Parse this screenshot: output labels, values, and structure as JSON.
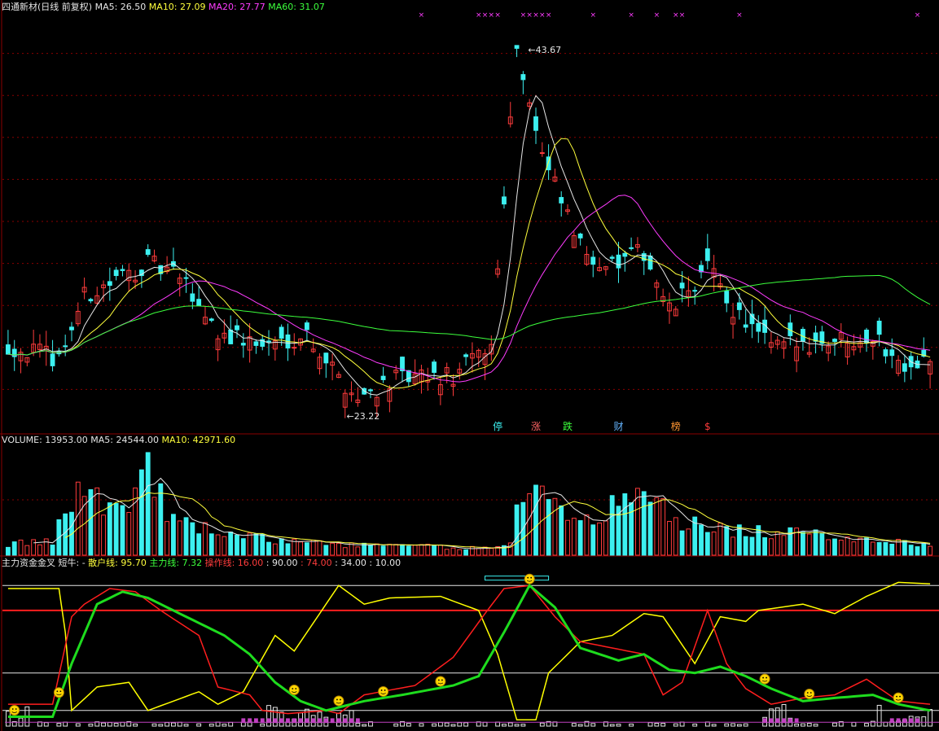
{
  "title": "四通新材(日线 前复权)",
  "legend_top": [
    {
      "label": "MA5: 26.50",
      "color": "#e6e6e6"
    },
    {
      "label": "MA10: 27.09",
      "color": "#ffff3c"
    },
    {
      "label": "MA20: 27.77",
      "color": "#ff3cff"
    },
    {
      "label": "MA60: 31.07",
      "color": "#3cff3c"
    }
  ],
  "legend_volume": [
    {
      "label": "VOLUME: 13953.00",
      "color": "#e6e6e6"
    },
    {
      "label": "MA5: 24544.00",
      "color": "#e6e6e6"
    },
    {
      "label": "MA10: 42971.60",
      "color": "#ffff3c"
    }
  ],
  "legend_ind": [
    {
      "label": "主力资金金叉",
      "color": "#e6e6e6"
    },
    {
      "label": "短牛: -",
      "color": "#e6e6e6"
    },
    {
      "label": "散户线: 95.70",
      "color": "#ffff3c"
    },
    {
      "label": "主力线: 7.32",
      "color": "#3cff3c"
    },
    {
      "label": "操作线: 16.00",
      "color": "#ff3c3c"
    },
    {
      "label": ": 90.00",
      "color": "#e6e6e6"
    },
    {
      "label": ": 74.00",
      "color": "#ff3c3c"
    },
    {
      "label": ": 34.00",
      "color": "#e6e6e6"
    },
    {
      "label": ": 10.00",
      "color": "#e6e6e6"
    }
  ],
  "annot_high": "43.67",
  "annot_low": "23.22",
  "event_markers": [
    {
      "text": "停",
      "color": "#3cf0f0"
    },
    {
      "text": "涨",
      "color": "#ff6464"
    },
    {
      "text": "跌",
      "color": "#3cff3c"
    },
    {
      "text": "财",
      "color": "#64b4ff"
    },
    {
      "text": "榜",
      "color": "#ff9632"
    },
    {
      "text": "$",
      "color": "#ff3c3c"
    }
  ],
  "colors": {
    "up": "#ff3c3c",
    "down": "#3cf0f0",
    "ma5": "#e6e6e6",
    "ma10": "#ffff3c",
    "ma20": "#ff3cff",
    "ma60": "#3cff3c",
    "grid": "#8b0000",
    "ind_red": "#ff1e1e",
    "ind_yellow": "#ffff00",
    "ind_green": "#1edc1e"
  },
  "chart_data": {
    "type": "candlestick",
    "count": 146,
    "ylim": [
      21.5,
      45.5
    ],
    "vol_max": 100,
    "ind_ylim": [
      0,
      100
    ],
    "price_path": [
      [
        0,
        26.4
      ],
      [
        8,
        25.7
      ],
      [
        12,
        29.2
      ],
      [
        22,
        31.1
      ],
      [
        27,
        30.3
      ],
      [
        33,
        27.2
      ],
      [
        40,
        26.4
      ],
      [
        47,
        27.1
      ],
      [
        52,
        24.6
      ],
      [
        55,
        23.4
      ],
      [
        60,
        24.4
      ],
      [
        70,
        24.6
      ],
      [
        76,
        26.5
      ],
      [
        80,
        43.6
      ],
      [
        84,
        37.2
      ],
      [
        90,
        32.0
      ],
      [
        95,
        30.9
      ],
      [
        100,
        31.8
      ],
      [
        104,
        28.3
      ],
      [
        110,
        30.9
      ],
      [
        114,
        28.5
      ],
      [
        120,
        26.3
      ],
      [
        130,
        26.8
      ],
      [
        136,
        27.0
      ],
      [
        140,
        25.5
      ],
      [
        145,
        25.6
      ]
    ],
    "vol_path": [
      [
        0,
        10
      ],
      [
        7,
        12
      ],
      [
        10,
        50
      ],
      [
        12,
        70
      ],
      [
        15,
        45
      ],
      [
        20,
        55
      ],
      [
        22,
        80
      ],
      [
        26,
        30
      ],
      [
        35,
        18
      ],
      [
        45,
        12
      ],
      [
        55,
        9
      ],
      [
        65,
        8
      ],
      [
        75,
        6
      ],
      [
        79,
        12
      ],
      [
        81,
        66
      ],
      [
        84,
        50
      ],
      [
        88,
        35
      ],
      [
        95,
        42
      ],
      [
        100,
        60
      ],
      [
        105,
        30
      ],
      [
        112,
        24
      ],
      [
        120,
        20
      ],
      [
        130,
        18
      ],
      [
        140,
        12
      ],
      [
        145,
        8
      ]
    ],
    "ind_yellow_path": [
      [
        0,
        88
      ],
      [
        8,
        88
      ],
      [
        9,
        60
      ],
      [
        10,
        10
      ],
      [
        14,
        25
      ],
      [
        19,
        28
      ],
      [
        22,
        10
      ],
      [
        30,
        22
      ],
      [
        33,
        14
      ],
      [
        37,
        22
      ],
      [
        42,
        58
      ],
      [
        45,
        48
      ],
      [
        50,
        78
      ],
      [
        52,
        90
      ],
      [
        56,
        78
      ],
      [
        60,
        82
      ],
      [
        68,
        83
      ],
      [
        74,
        74
      ],
      [
        77,
        46
      ],
      [
        80,
        4
      ],
      [
        83,
        4
      ],
      [
        85,
        34
      ],
      [
        87,
        42
      ],
      [
        90,
        54
      ],
      [
        95,
        58
      ],
      [
        100,
        72
      ],
      [
        103,
        70
      ],
      [
        108,
        40
      ],
      [
        112,
        70
      ],
      [
        116,
        67
      ],
      [
        118,
        74
      ],
      [
        125,
        78
      ],
      [
        130,
        72
      ],
      [
        135,
        83
      ],
      [
        140,
        92
      ],
      [
        145,
        91
      ]
    ],
    "ind_red_path": [
      [
        0,
        14
      ],
      [
        7,
        14
      ],
      [
        10,
        70
      ],
      [
        12,
        78
      ],
      [
        16,
        88
      ],
      [
        20,
        86
      ],
      [
        24,
        74
      ],
      [
        30,
        58
      ],
      [
        33,
        25
      ],
      [
        38,
        20
      ],
      [
        40,
        10
      ],
      [
        44,
        8
      ],
      [
        50,
        10
      ],
      [
        52,
        8
      ],
      [
        56,
        20
      ],
      [
        64,
        26
      ],
      [
        70,
        44
      ],
      [
        75,
        72
      ],
      [
        78,
        88
      ],
      [
        82,
        90
      ],
      [
        86,
        70
      ],
      [
        90,
        54
      ],
      [
        95,
        50
      ],
      [
        100,
        46
      ],
      [
        103,
        20
      ],
      [
        106,
        28
      ],
      [
        110,
        74
      ],
      [
        113,
        40
      ],
      [
        116,
        24
      ],
      [
        120,
        14
      ],
      [
        125,
        18
      ],
      [
        130,
        20
      ],
      [
        135,
        30
      ],
      [
        140,
        16
      ],
      [
        145,
        14
      ]
    ],
    "ind_green_path": [
      [
        0,
        6
      ],
      [
        7,
        6
      ],
      [
        10,
        40
      ],
      [
        14,
        78
      ],
      [
        18,
        86
      ],
      [
        22,
        82
      ],
      [
        28,
        70
      ],
      [
        34,
        58
      ],
      [
        38,
        46
      ],
      [
        42,
        28
      ],
      [
        46,
        16
      ],
      [
        50,
        10
      ],
      [
        56,
        16
      ],
      [
        62,
        20
      ],
      [
        70,
        26
      ],
      [
        74,
        32
      ],
      [
        78,
        60
      ],
      [
        82,
        90
      ],
      [
        86,
        76
      ],
      [
        90,
        50
      ],
      [
        96,
        42
      ],
      [
        100,
        46
      ],
      [
        104,
        36
      ],
      [
        108,
        34
      ],
      [
        112,
        38
      ],
      [
        116,
        32
      ],
      [
        120,
        24
      ],
      [
        125,
        16
      ],
      [
        130,
        18
      ],
      [
        136,
        20
      ],
      [
        140,
        14
      ],
      [
        145,
        10
      ]
    ],
    "ind_levels": [
      90,
      74,
      34,
      10
    ],
    "ind_level_colors": [
      "#e6e6e6",
      "#ff1e1e",
      "#e6e6e6",
      "#e6e6e6"
    ],
    "smileys": [
      1,
      8,
      45,
      52,
      59,
      68,
      82,
      119,
      126,
      140
    ]
  }
}
